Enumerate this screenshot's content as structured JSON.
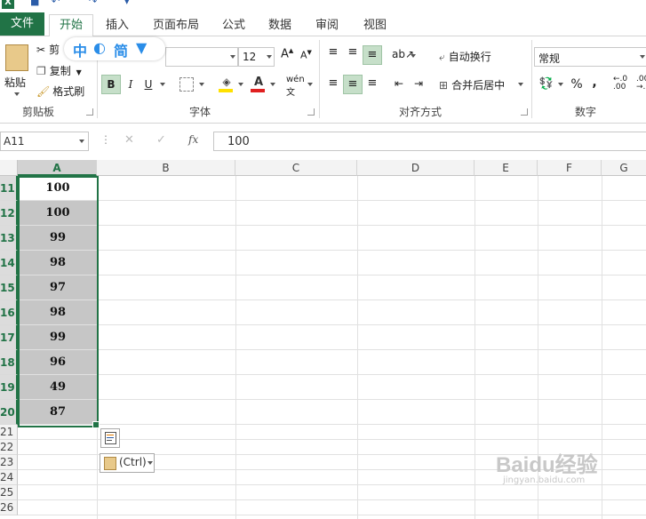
{
  "ribbon_tabs": [
    "文件",
    "开始",
    "插入",
    "页面布局",
    "公式",
    "数据",
    "审阅",
    "视图"
  ],
  "clipboard": {
    "cut": "剪",
    "copy": "复制",
    "format_painter": "格式刷",
    "paste": "粘贴",
    "label": "剪贴板"
  },
  "ime": {
    "zh": "中",
    "simplified": "简"
  },
  "font": {
    "size": "12",
    "bold": "B",
    "italic": "I",
    "underline": "U",
    "label": "字体"
  },
  "alignment": {
    "wrap_text": "自动换行",
    "merge_center": "合并后居中",
    "label": "对齐方式"
  },
  "number": {
    "format": "常规",
    "percent": "%",
    "comma": ",",
    "label": "数字"
  },
  "formula_bar": {
    "name_box": "A11",
    "fx": "fx",
    "value": "100"
  },
  "columns": [
    "A",
    "B",
    "C",
    "D",
    "E",
    "F",
    "G"
  ],
  "rows": [
    "11",
    "12",
    "13",
    "14",
    "15",
    "16",
    "17",
    "18",
    "19",
    "20",
    "21",
    "22",
    "23",
    "24",
    "25",
    "26"
  ],
  "column_a_values": [
    "100",
    "100",
    "99",
    "98",
    "97",
    "98",
    "99",
    "96",
    "49",
    "87"
  ],
  "paste_options": {
    "label": "(Ctrl)"
  },
  "watermark": {
    "text": "Baidu经验",
    "url": "jingyan.baidu.com"
  },
  "colors": {
    "excel_green": "#217346",
    "selection_fill": "#c6c6c6",
    "highlight": "#c6dfc9",
    "font_color_red": "#e02020",
    "fill_yellow": "#ffe100"
  }
}
